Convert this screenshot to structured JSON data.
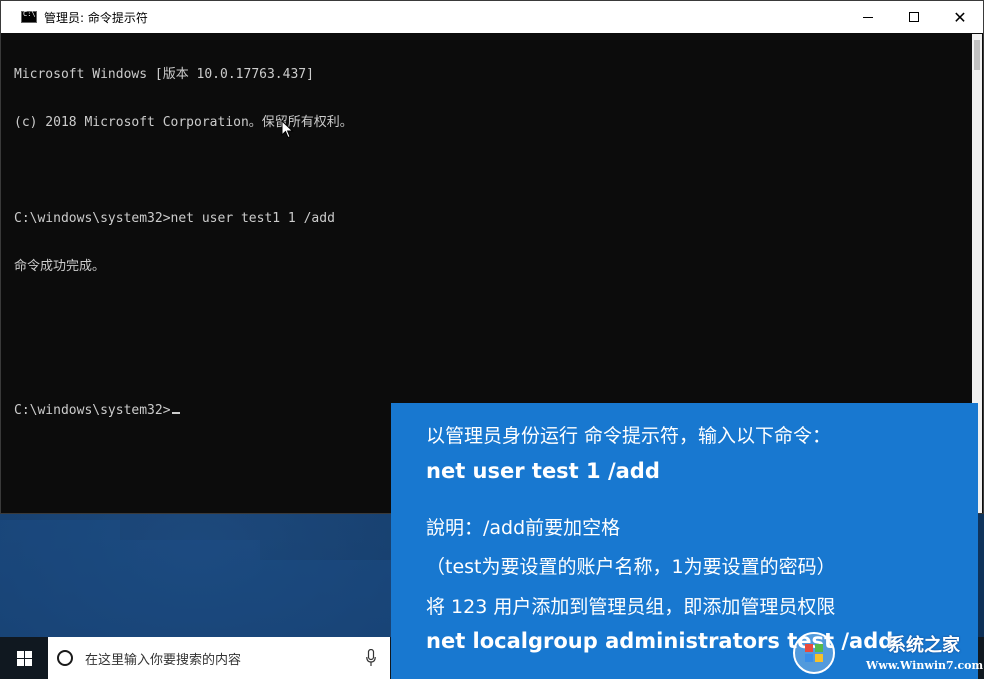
{
  "window": {
    "title": "管理员: 命令提示符",
    "controls": {
      "minimize_icon": "minimize-icon",
      "maximize_icon": "maximize-icon",
      "close_glyph": "✕"
    }
  },
  "console": {
    "lines": [
      "Microsoft Windows [版本 10.0.17763.437]",
      "(c) 2018 Microsoft Corporation。保留所有权利。",
      "",
      "C:\\windows\\system32>net user test1 1 /add",
      "命令成功完成。",
      "",
      "",
      "C:\\windows\\system32>"
    ]
  },
  "taskbar": {
    "search_placeholder": "在这里输入你要搜索的内容"
  },
  "overlay": {
    "line1": "以管理员身份运行 命令提示符，输入以下命令：",
    "line2": "net user test 1 /add",
    "line3": "說明：/add前要加空格",
    "line4": "（test为要设置的账户名称，1为要设置的密码）",
    "line5": "将 123 用户添加到管理员组，即添加管理员权限",
    "line6": "net localgroup administrators test /add",
    "background_color": "#1878d0"
  },
  "watermark": {
    "brand": "系统之家",
    "url": "Www.Winwin7.com"
  }
}
